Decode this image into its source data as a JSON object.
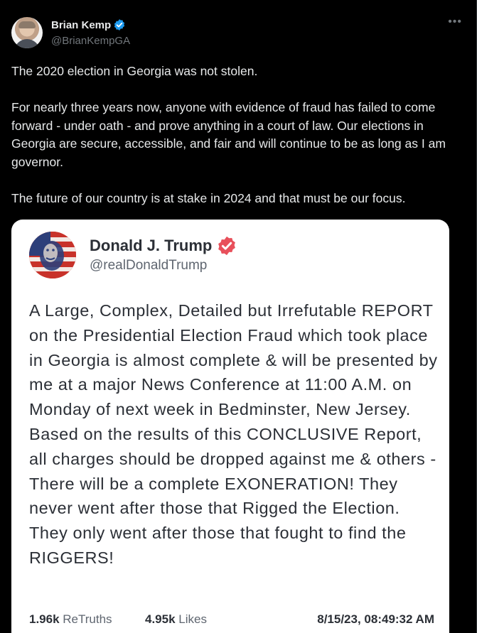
{
  "tweet": {
    "author_name": "Brian Kemp",
    "author_handle": "@BrianKempGA",
    "more_icon": "•••",
    "verified_color": "#1d9bf0",
    "paragraphs": [
      "The 2020 election in Georgia was not stolen.",
      "For nearly three years now, anyone with evidence of fraud has failed to come forward - under oath - and prove anything in a court of law. Our elections in Georgia are secure, accessible, and fair and will continue to be as long as I am governor.",
      "The future of our country is at stake in 2024 and that must be our focus."
    ]
  },
  "embedded_post": {
    "author_name": "Donald J. Trump",
    "author_handle": "@realDonaldTrump",
    "verified_color": "#e8505b",
    "text": "A Large, Complex, Detailed but Irrefutable REPORT on the Presidential Election Fraud which took place in Georgia is almost complete & will be presented by me at a major News Conference at 11:00 A.M. on Monday of next week in Bedminster, New Jersey. Based on the results of this CONCLUSIVE Report, all charges should be dropped against me & others - There will be a complete EXONERATION! They never went after those that Rigged the Election. They only went after those that fought to find the RIGGERS!",
    "retruths_count": "1.96k",
    "retruths_label": "ReTruths",
    "likes_count": "4.95k",
    "likes_label": "Likes",
    "timestamp": "8/15/23, 08:49:32 AM"
  }
}
